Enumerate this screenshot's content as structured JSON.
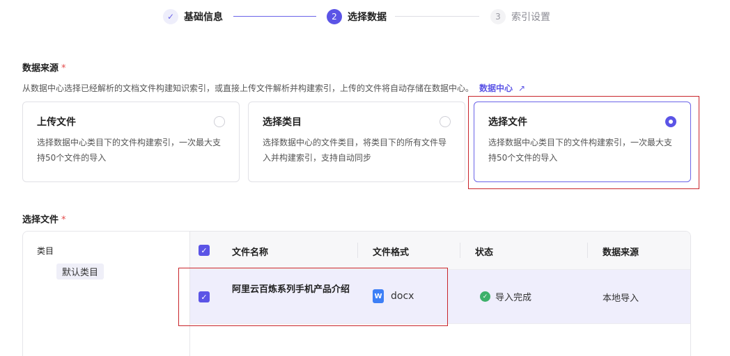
{
  "stepper": {
    "steps": [
      {
        "marker": "✓",
        "label": "基础信息"
      },
      {
        "marker": "2",
        "label": "选择数据"
      },
      {
        "marker": "3",
        "label": "索引设置"
      }
    ]
  },
  "data_source": {
    "label": "数据来源",
    "required_mark": "*",
    "description": "从数据中心选择已经解析的文档文件构建知识索引，或直接上传文件解析并构建索引，上传的文件将自动存储在数据中心。",
    "link_label": "数据中心",
    "link_icon": "external-link-icon",
    "options": [
      {
        "title": "上传文件",
        "description": "选择数据中心类目下的文件构建索引，一次最大支持50个文件的导入",
        "selected": false
      },
      {
        "title": "选择类目",
        "description": "选择数据中心的文件类目，将类目下的所有文件导入并构建索引，支持自动同步",
        "selected": false
      },
      {
        "title": "选择文件",
        "description": "选择数据中心类目下的文件构建索引，一次最大支持50个文件的导入",
        "selected": true
      }
    ]
  },
  "file_select": {
    "label": "选择文件",
    "required_mark": "*",
    "category_title": "类目",
    "categories": [
      "默认类目"
    ],
    "columns": [
      "文件名称",
      "文件格式",
      "状态",
      "数据来源"
    ],
    "rows": [
      {
        "name": "阿里云百炼系列手机产品介绍",
        "format": "docx",
        "format_icon": "word-file-icon",
        "status": "导入完成",
        "status_icon": "success-check-icon",
        "source": "本地导入",
        "checked": true
      }
    ]
  },
  "colors": {
    "accent": "#5b54e6",
    "highlight_border": "#c8242a",
    "success": "#3db06a",
    "required": "#e34b4b"
  }
}
